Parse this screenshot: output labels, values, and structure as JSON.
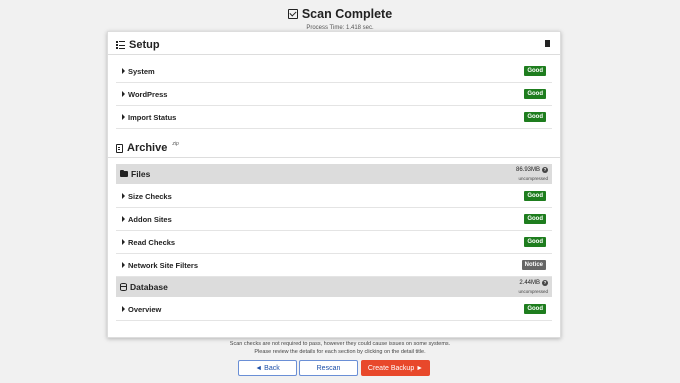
{
  "header": {
    "title": "Scan Complete",
    "process_time": "Process Time: 1.418 sec."
  },
  "setup": {
    "title": "Setup",
    "rows": [
      {
        "label": "System",
        "status": "Good"
      },
      {
        "label": "WordPress",
        "status": "Good"
      },
      {
        "label": "Import Status",
        "status": "Good"
      }
    ]
  },
  "archive": {
    "title": "Archive",
    "suffix": "zip",
    "files": {
      "label": "Files",
      "size": "86.93MB",
      "size_note": "uncompressed",
      "rows": [
        {
          "label": "Size Checks",
          "status": "Good"
        },
        {
          "label": "Addon Sites",
          "status": "Good"
        },
        {
          "label": "Read Checks",
          "status": "Good"
        },
        {
          "label": "Network Site Filters",
          "status": "Notice"
        }
      ]
    },
    "database": {
      "label": "Database",
      "size": "2.44MB",
      "size_note": "uncompressed",
      "rows": [
        {
          "label": "Overview",
          "status": "Good"
        }
      ]
    }
  },
  "footnote": {
    "line1": "Scan checks are not required to pass, however they could cause issues on some systems.",
    "line2": "Please review the details for each section by clicking on the detail title."
  },
  "buttons": {
    "back": "◄ Back",
    "rescan": "Rescan",
    "create": "Create Backup ►"
  },
  "colors": {
    "good": "#1e7d1e",
    "notice": "#666666",
    "primary": "#e8482b"
  }
}
